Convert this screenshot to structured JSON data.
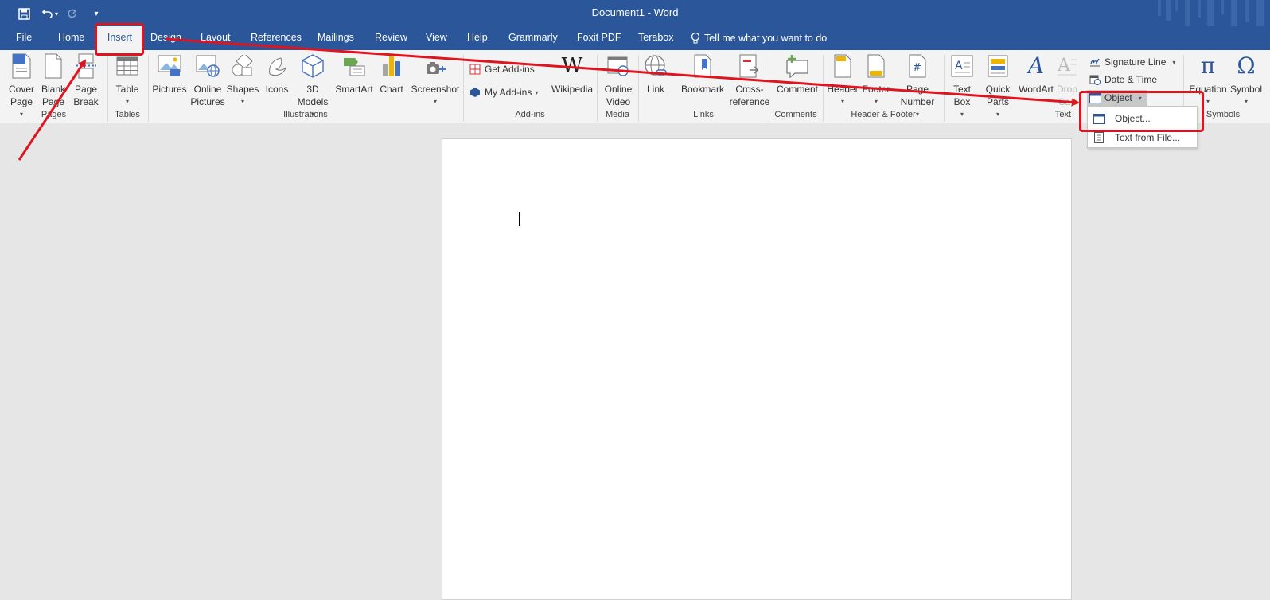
{
  "title_bar": {
    "title": "Document1  -  Word"
  },
  "tabs": [
    "File",
    "Home",
    "Insert",
    "Design",
    "Layout",
    "References",
    "Mailings",
    "Review",
    "View",
    "Help",
    "Grammarly",
    "Foxit PDF",
    "Terabox"
  ],
  "tell_me": "Tell me what you want to do",
  "groups": {
    "pages": {
      "label": "Pages",
      "cover": [
        "Cover",
        "Page"
      ],
      "blank": [
        "Blank",
        "Page"
      ],
      "break": [
        "Page",
        "Break"
      ]
    },
    "tables": {
      "label": "Tables",
      "table": "Table"
    },
    "illustrations": {
      "label": "Illustrations",
      "pictures": "Pictures",
      "online": [
        "Online",
        "Pictures"
      ],
      "shapes": "Shapes",
      "icons": "Icons",
      "models": [
        "3D",
        "Models"
      ],
      "smartart": "SmartArt",
      "chart": "Chart",
      "screenshot": "Screenshot"
    },
    "addins": {
      "label": "Add-ins",
      "get": "Get Add-ins",
      "my": "My Add-ins",
      "wiki": "Wikipedia"
    },
    "media": {
      "label": "Media",
      "video": [
        "Online",
        "Video"
      ]
    },
    "links": {
      "label": "Links",
      "link": "Link",
      "bookmark": "Bookmark",
      "cross": [
        "Cross-",
        "reference"
      ]
    },
    "comments": {
      "label": "Comments",
      "comment": "Comment"
    },
    "header_footer": {
      "label": "Header & Footer",
      "header": "Header",
      "footer": "Footer",
      "page_number": [
        "Page",
        "Number"
      ]
    },
    "text": {
      "label": "Text",
      "textbox": [
        "Text",
        "Box"
      ],
      "quickparts": [
        "Quick",
        "Parts"
      ],
      "wordart": "WordArt",
      "dropcap": [
        "Drop",
        "Cap"
      ],
      "signature": "Signature Line",
      "datetime": "Date & Time",
      "object": "Object"
    },
    "symbols": {
      "label": "Symbols",
      "equation": "Equation",
      "symbol": "Symbol"
    }
  },
  "object_menu": {
    "item1": "Object...",
    "item2": "Text from File..."
  },
  "colors": {
    "accent": "#2b579a",
    "annotation": "#e0141e"
  }
}
